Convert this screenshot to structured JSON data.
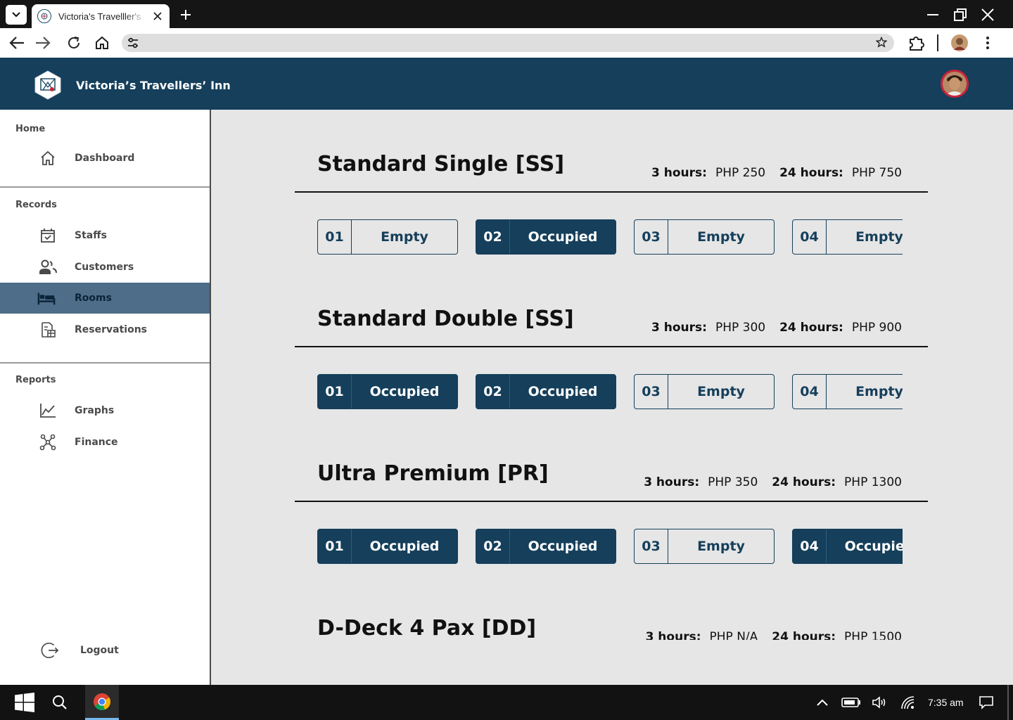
{
  "browser": {
    "tab_title": "Victoria's Travelller's",
    "url": ""
  },
  "header": {
    "brand": "Victoria’s Travellers’ Inn"
  },
  "sidebar": {
    "home_title": "Home",
    "records_title": "Records",
    "reports_title": "Reports",
    "items": [
      {
        "label": "Dashboard",
        "icon": "home-icon"
      },
      {
        "label": "Staffs",
        "icon": "calendar-check-icon"
      },
      {
        "label": "Customers",
        "icon": "users-icon"
      },
      {
        "label": "Rooms",
        "icon": "bed-icon"
      },
      {
        "label": "Reservations",
        "icon": "document-icon"
      },
      {
        "label": "Graphs",
        "icon": "line-chart-icon"
      },
      {
        "label": "Finance",
        "icon": "network-icon"
      }
    ],
    "logout_label": "Logout",
    "active_item": "Rooms"
  },
  "room_types": [
    {
      "title": "Standard Single [SS]",
      "rate_3h_label": "3 hours:",
      "rate_3h": "PHP 250",
      "rate_24h_label": "24 hours:",
      "rate_24h": "PHP 750",
      "rooms": [
        {
          "number": "01",
          "status": "Empty"
        },
        {
          "number": "02",
          "status": "Occupied"
        },
        {
          "number": "03",
          "status": "Empty"
        },
        {
          "number": "04",
          "status": "Empty"
        }
      ]
    },
    {
      "title": "Standard Double [SS]",
      "rate_3h_label": "3 hours:",
      "rate_3h": "PHP 300",
      "rate_24h_label": "24 hours:",
      "rate_24h": "PHP 900",
      "rooms": [
        {
          "number": "01",
          "status": "Occupied"
        },
        {
          "number": "02",
          "status": "Occupied"
        },
        {
          "number": "03",
          "status": "Empty"
        },
        {
          "number": "04",
          "status": "Empty"
        }
      ]
    },
    {
      "title": "Ultra Premium [PR]",
      "rate_3h_label": "3 hours:",
      "rate_3h": "PHP 350",
      "rate_24h_label": "24 hours:",
      "rate_24h": "PHP 1300",
      "rooms": [
        {
          "number": "01",
          "status": "Occupied"
        },
        {
          "number": "02",
          "status": "Occupied"
        },
        {
          "number": "03",
          "status": "Empty"
        },
        {
          "number": "04",
          "status": "Occupied"
        }
      ]
    },
    {
      "title": "D-Deck 4 Pax [DD]",
      "rate_3h_label": "3 hours:",
      "rate_3h": "PHP N/A",
      "rate_24h_label": "24 hours:",
      "rate_24h": "PHP 1500",
      "rooms": []
    }
  ],
  "colors": {
    "header_bg": "#153f5b",
    "occupied": "#153f5b",
    "active_nav": "#4d6d88",
    "content_bg": "#e6e6e6"
  },
  "taskbar": {
    "time": "7:35 am"
  }
}
